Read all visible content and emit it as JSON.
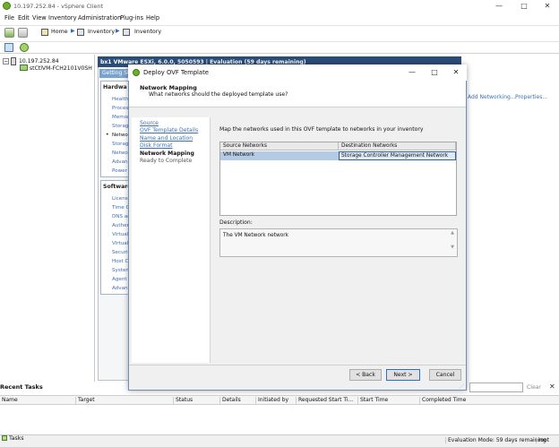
{
  "window": {
    "title": "10.197.252.84 - vSphere Client",
    "controls": [
      "—",
      "□",
      "✕"
    ]
  },
  "menu": [
    "File",
    "Edit",
    "View",
    "Inventory",
    "Administration",
    "Plug-ins",
    "Help"
  ],
  "breadcrumb": {
    "home": "Home",
    "inventory1": "Inventory",
    "inventory2": "Inventory"
  },
  "tree": {
    "host": "10.197.252.84",
    "vm": "stCtlVM-FCH2101V0SH"
  },
  "host_panel": {
    "header": "bx1 VMware ESXi, 6.0.0, 5050593 | Evaluation (59 days remaining)",
    "tab": "Getting St",
    "hardware_title": "Hardwa",
    "hardware_items": [
      "Health",
      "Proces",
      "Memor",
      "Storag",
      "Netwo",
      "Storag",
      "Netwo",
      "Advan",
      "Power"
    ],
    "software_title": "Software",
    "software_items": [
      "Licens",
      "Time C",
      "DNS ar",
      "Authen",
      "Virtual",
      "Virtual",
      "Securit",
      "Host C",
      "System",
      "Agent",
      "Advan"
    ],
    "add_networking": "Add Networking...",
    "properties": "Properties..."
  },
  "dialog": {
    "title": "Deploy OVF Template",
    "header_title": "Network Mapping",
    "header_subtitle": "What networks should the deployed template use?",
    "steps": [
      {
        "label": "Source",
        "state": "link"
      },
      {
        "label": "OVF Template Details",
        "state": "link"
      },
      {
        "label": "Name and Location",
        "state": "link"
      },
      {
        "label": "Disk Format",
        "state": "link"
      },
      {
        "label": "Network Mapping",
        "state": "active"
      },
      {
        "label": "Ready to Complete",
        "state": "pending"
      }
    ],
    "instruction": "Map the networks used in this OVF template to networks in your inventory",
    "table": {
      "col_source": "Source Networks",
      "col_dest": "Destination Networks",
      "rows": [
        {
          "source": "VM Network",
          "destination": "Storage Controller Management Network"
        }
      ]
    },
    "description_label": "Description:",
    "description_text": "The VM Network network",
    "buttons": {
      "back": "< Back",
      "next": "Next >",
      "cancel": "Cancel"
    }
  },
  "recent_tasks": {
    "title": "Recent Tasks",
    "filter_clear": "Clear",
    "columns": [
      "Name",
      "Target",
      "Status",
      "Details",
      "Initiated by",
      "Requested Start Ti...",
      "Start Time",
      "Completed Time"
    ]
  },
  "statusbar": {
    "tasks": "Tasks",
    "evaluation": "Evaluation Mode: 59 days remaining",
    "user": "root"
  }
}
